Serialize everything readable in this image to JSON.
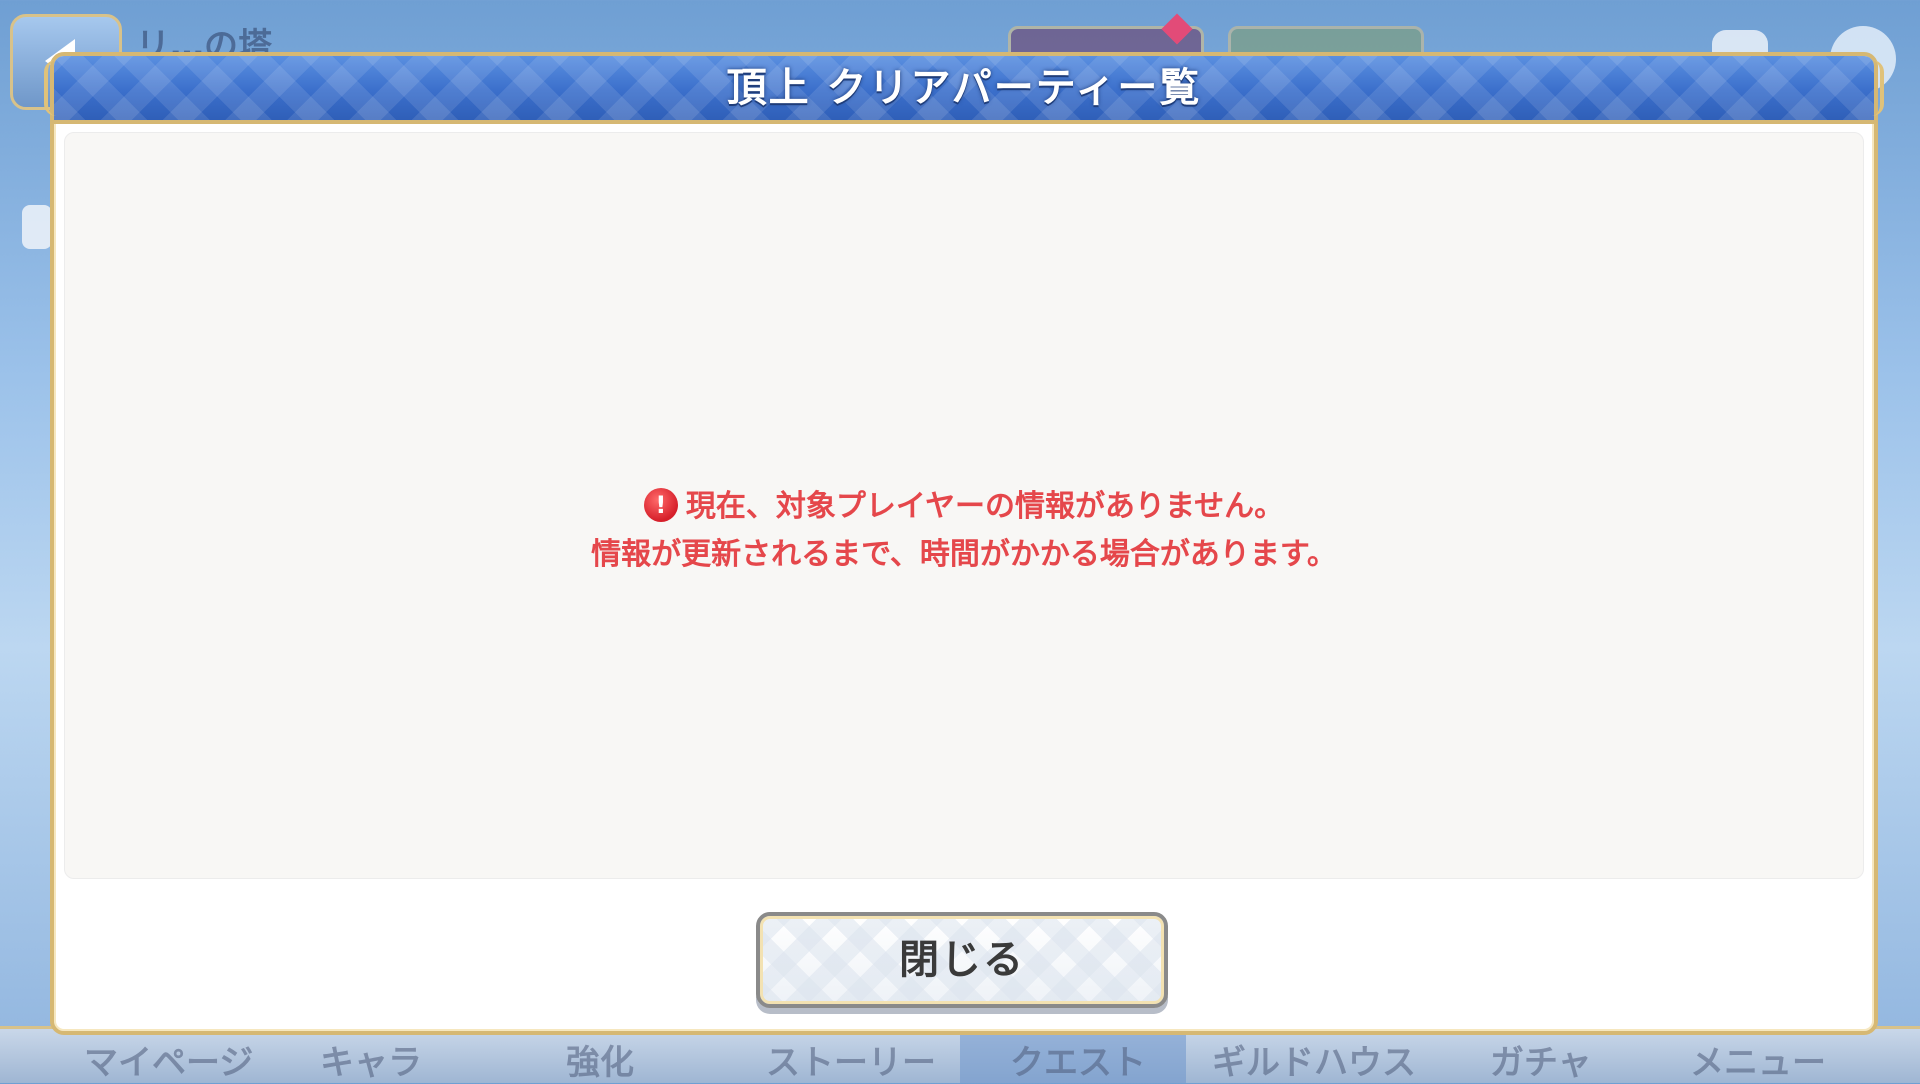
{
  "background": {
    "title": "リ…の塔",
    "nav_items": [
      "マイページ",
      "キャラ",
      "強化",
      "ストーリー",
      "クエスト",
      "ギルドハウス",
      "ガチャ",
      "メニュー"
    ]
  },
  "dialog": {
    "title": "頂上 クリアパーティー覧",
    "message_line1": "現在、対象プレイヤーの情報がありません。",
    "message_line2": "情報が更新されるまで、時間がかかる場合があります。",
    "close_label": "閉じる"
  },
  "icons": {
    "warning": "exclamation-circle-icon",
    "back": "back-arrow-icon"
  },
  "colors": {
    "header_blue": "#3b6fcb",
    "gold_border": "#d6b873",
    "message_red": "#e5474b"
  }
}
